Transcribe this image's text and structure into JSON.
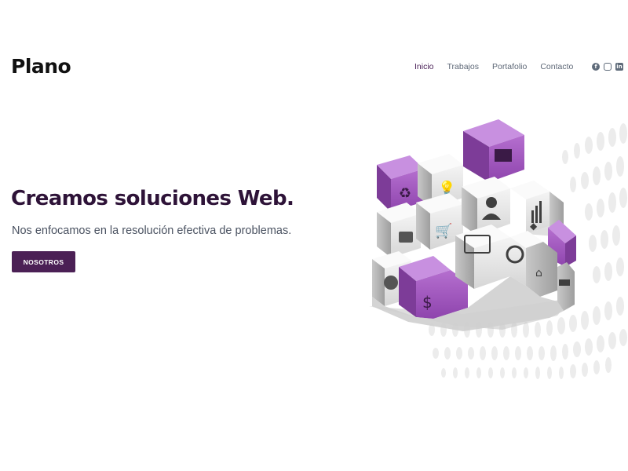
{
  "brand": {
    "logo_text": "Plano"
  },
  "nav": {
    "items": [
      {
        "label": "Inicio",
        "active": true
      },
      {
        "label": "Trabajos",
        "active": false
      },
      {
        "label": "Portafolio",
        "active": false
      },
      {
        "label": "Contacto",
        "active": false
      }
    ]
  },
  "social": {
    "icons": [
      "facebook-icon",
      "instagram-icon",
      "linkedin-icon"
    ]
  },
  "hero": {
    "title": "Creamos soluciones Web.",
    "subtitle": "Nos enfocamos en la resolución efectiva de problemas.",
    "button_label": "NOSOTROS"
  },
  "illustration": {
    "icons": [
      "recycle-icon",
      "lightbulb-icon",
      "folder-icon",
      "lock-icon",
      "cart-icon",
      "user-icon",
      "chart-icon",
      "tag-icon",
      "money-bag-icon",
      "card-icon",
      "clock-money-icon",
      "check-icon",
      "price-tag-icon",
      "wallet-icon"
    ]
  },
  "colors": {
    "brand_purple": "#4b2055",
    "cube_purple": "#9b59b6",
    "nav_text": "#5e6877"
  }
}
